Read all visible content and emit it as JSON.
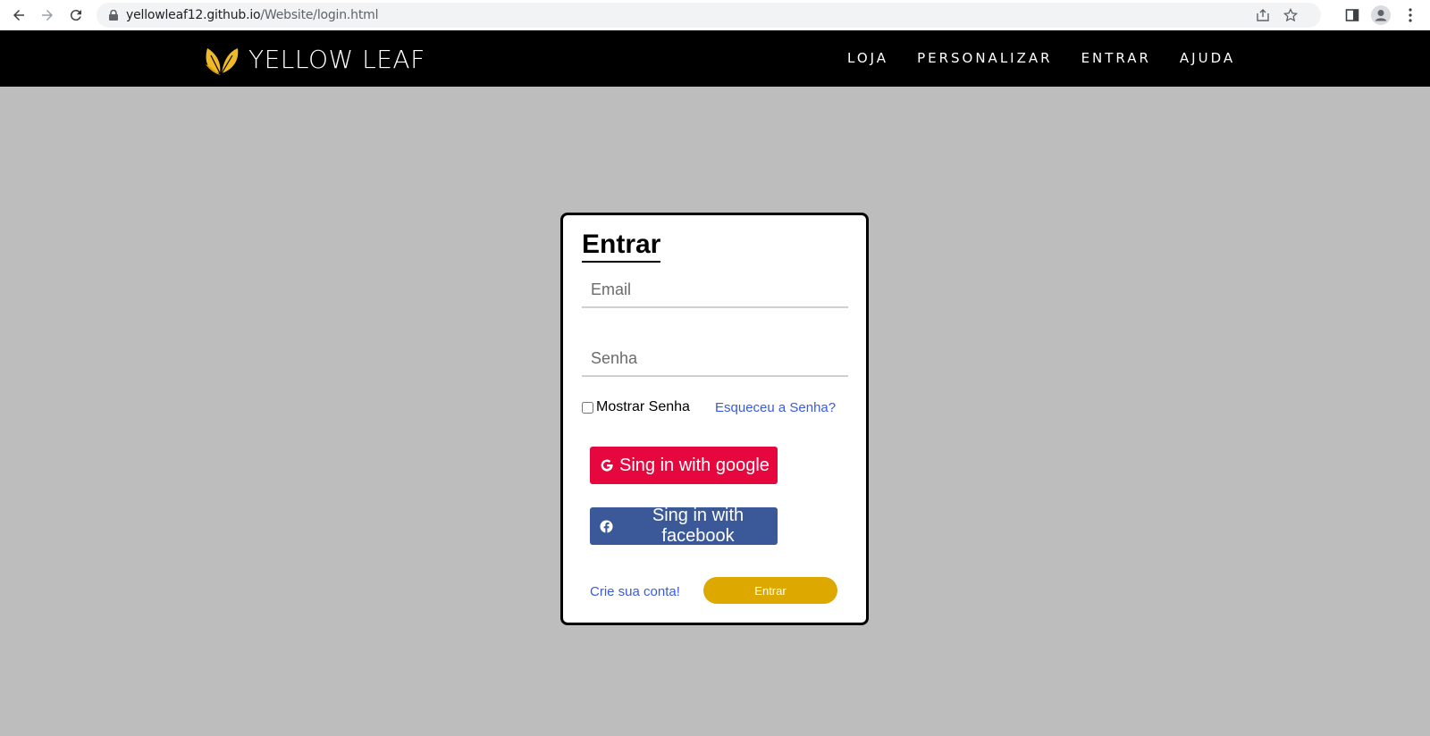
{
  "browser": {
    "url_domain": "yellowleaf12.github.io",
    "url_path": "/Website/login.html"
  },
  "header": {
    "brand": "YELLOW LEAF",
    "nav": [
      "LOJA",
      "PERSONALIZAR",
      "ENTRAR",
      "AJUDA"
    ]
  },
  "login": {
    "title": "Entrar",
    "email_placeholder": "Email",
    "password_placeholder": "Senha",
    "show_password_label": "Mostrar Senha",
    "forgot_link": "Esqueceu a Senha?",
    "google_button": "Sing in with google",
    "facebook_button": "Sing in with facebook",
    "create_account_link": "Crie sua conta!",
    "submit_button": "Entrar"
  },
  "colors": {
    "background": "#bdbdbd",
    "header": "#000000",
    "google": "#e6073f",
    "facebook": "#3b5998",
    "submit": "#dda800",
    "link": "#3b5bdb"
  }
}
